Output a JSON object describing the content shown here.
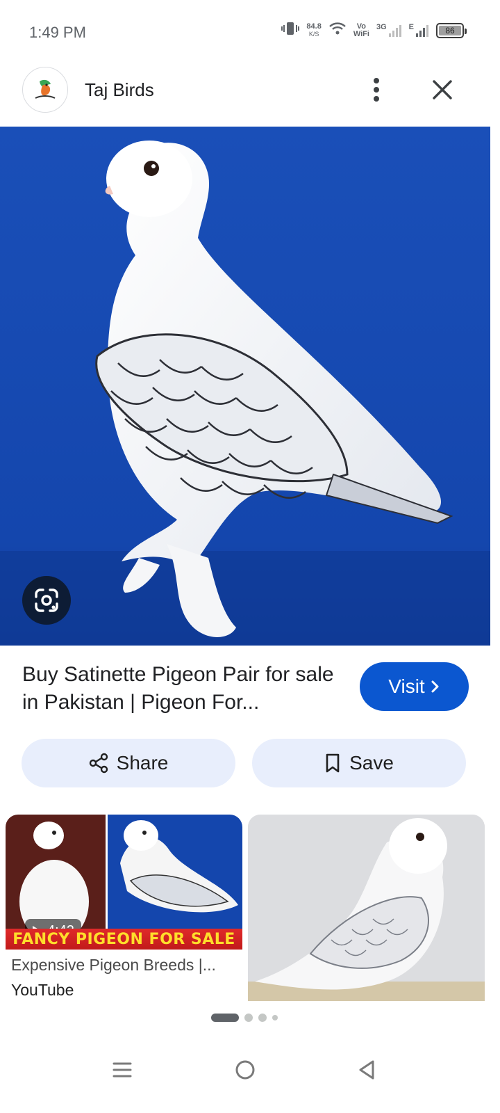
{
  "status_bar": {
    "time": "1:49 PM",
    "speed_value": "84.8",
    "speed_unit": "K/S",
    "volte_top": "Vo",
    "volte_bottom": "WiFi",
    "network_3g": "3G",
    "network_e": "E",
    "battery_level": "86"
  },
  "header": {
    "site_name": "Taj Birds",
    "icons": [
      "site-logo",
      "more-vertical",
      "close"
    ]
  },
  "hero": {
    "image_subject": "white satinette pigeon on blue background",
    "lens_icon": "google-lens"
  },
  "result": {
    "title": "Buy Satinette Pigeon Pair for sale in Pakistan | Pigeon For...",
    "visit_label": "Visit"
  },
  "actions": {
    "share_label": "Share",
    "save_label": "Save"
  },
  "related": {
    "card1": {
      "duration": "4:42",
      "banner_text": "FANCY PIGEON FOR SALE",
      "title": "Expensive Pigeon Breeds |...",
      "source": "YouTube"
    }
  },
  "pager": {
    "count": 4,
    "active_index": 0
  },
  "navbar": {
    "icons": [
      "menu",
      "home",
      "back"
    ]
  },
  "colors": {
    "accent": "#0b57d0",
    "chip_bg": "#e8eefc",
    "hero_bg": "#1346a8"
  }
}
